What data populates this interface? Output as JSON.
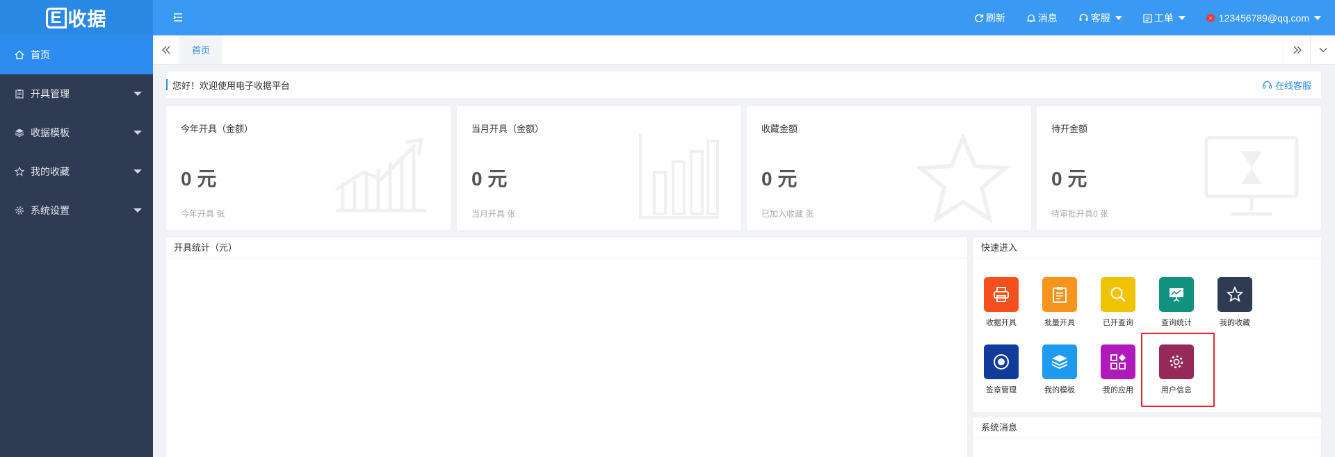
{
  "app": {
    "logo_e": "E",
    "logo_text": "收据"
  },
  "sidebar": {
    "items": [
      {
        "label": "首页",
        "icon": "home-icon"
      },
      {
        "label": "开具管理",
        "icon": "clipboard-icon"
      },
      {
        "label": "收据模板",
        "icon": "layers-icon"
      },
      {
        "label": "我的收藏",
        "icon": "star-icon"
      },
      {
        "label": "系统设置",
        "icon": "gear-icon"
      }
    ]
  },
  "header": {
    "refresh": "刷新",
    "messages": "消息",
    "support": "客服",
    "workorder": "工单",
    "user": "123456789@qq.com"
  },
  "tabs": {
    "home": "首页"
  },
  "welcome": {
    "text": "您好！欢迎使用电子收据平台",
    "online_service": "在线客服"
  },
  "stats": [
    {
      "title": "今年开具（金额）",
      "amount": "0 元",
      "sub": "今年开具 张"
    },
    {
      "title": "当月开具（金额）",
      "amount": "0 元",
      "sub": "当月开具 张"
    },
    {
      "title": "收藏金额",
      "amount": "0 元",
      "sub": "已加入收藏 张"
    },
    {
      "title": "待开金额",
      "amount": "0 元",
      "sub": "待审批开具0 张"
    }
  ],
  "panels": {
    "stats_title": "开具统计（元）",
    "quick_title": "快速进入",
    "sys_msg_title": "系统消息"
  },
  "quick": [
    {
      "label": "收据开具",
      "color": "#f2511d",
      "icon": "printer-icon"
    },
    {
      "label": "批量开具",
      "color": "#f7941d",
      "icon": "clipboard-icon"
    },
    {
      "label": "已开查询",
      "color": "#f0c300",
      "icon": "search-icon"
    },
    {
      "label": "查询统计",
      "color": "#11927f",
      "icon": "presentation-icon"
    },
    {
      "label": "我的收藏",
      "color": "#2f3b52",
      "icon": "star-icon"
    },
    {
      "label": "签章管理",
      "color": "#113b9a",
      "icon": "seal-icon"
    },
    {
      "label": "我的模板",
      "color": "#1e9bf0",
      "icon": "layers-icon"
    },
    {
      "label": "我的应用",
      "color": "#b019ba",
      "icon": "apps-icon"
    },
    {
      "label": "用户信息",
      "color": "#962b5b",
      "icon": "gear-icon"
    }
  ]
}
